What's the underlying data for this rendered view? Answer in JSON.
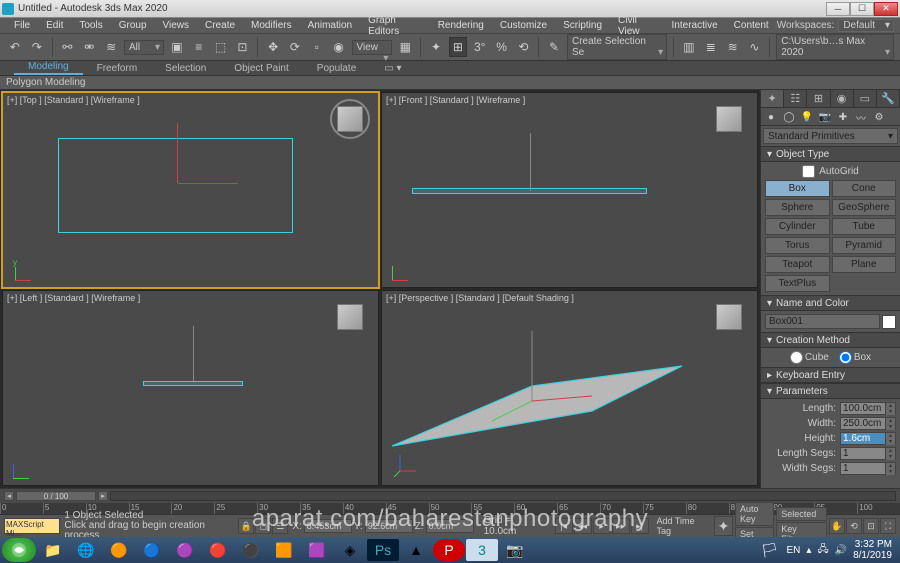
{
  "title": "Untitled - Autodesk 3ds Max 2020",
  "menus": [
    "File",
    "Edit",
    "Tools",
    "Group",
    "Views",
    "Create",
    "Modifiers",
    "Animation",
    "Graph Editors",
    "Rendering",
    "Customize",
    "Scripting",
    "Civil View",
    "Interactive",
    "Content"
  ],
  "workspaces_label": "Workspaces:",
  "workspaces_value": "Default",
  "toolbar_drop_all": "All",
  "toolbar_drop_view": "View",
  "toolbar_drop_sel": "Create Selection Se",
  "toolbar_path": "C:\\Users\\b…s Max 2020",
  "ribbon_tabs": [
    "Modeling",
    "Freeform",
    "Selection",
    "Object Paint",
    "Populate"
  ],
  "ribbon_sub": "Polygon Modeling",
  "viewports": {
    "top": "[+] [Top ] [Standard ] [Wireframe ]",
    "front": "[+] [Front ] [Standard ] [Wireframe ]",
    "left": "[+] [Left ] [Standard ] [Wireframe ]",
    "persp": "[+] [Perspective ] [Standard ] [Default Shading ]"
  },
  "cmd": {
    "category": "Standard Primitives",
    "rollouts": {
      "object_type": "Object Type",
      "autogrid": "AutoGrid",
      "primitives": [
        "Box",
        "Cone",
        "Sphere",
        "GeoSphere",
        "Cylinder",
        "Tube",
        "Torus",
        "Pyramid",
        "Teapot",
        "Plane",
        "TextPlus"
      ],
      "name_color": "Name and Color",
      "name_value": "Box001",
      "creation": "Creation Method",
      "creation_opts": [
        "Cube",
        "Box"
      ],
      "keyboard": "Keyboard Entry",
      "params": "Parameters",
      "length_lbl": "Length:",
      "length_val": "100.0cm",
      "width_lbl": "Width:",
      "width_val": "250.0cm",
      "height_lbl": "Height:",
      "height_val": "1.6cm",
      "lsegs_lbl": "Length Segs:",
      "lsegs_val": "1",
      "wsegs_lbl": "Width Segs:",
      "wsegs_val": "1"
    }
  },
  "timeline": {
    "frame": "0 / 100",
    "ticks": [
      "0",
      "5",
      "10",
      "15",
      "20",
      "25",
      "30",
      "35",
      "40",
      "45",
      "50",
      "55",
      "60",
      "65",
      "70",
      "75",
      "80",
      "85",
      "90",
      "95",
      "100"
    ]
  },
  "status": {
    "script": "MAXScript Mi…",
    "selected": "1 Object Selected",
    "hint": "Click and drag to begin creation process",
    "x_lbl": "X:",
    "x": "8.453cm",
    "y_lbl": "Y:",
    "y": "92.6cm",
    "z_lbl": "Z:",
    "z": "0.0cm",
    "grid": "Grid = 10.0cm",
    "addtime": "Add Time Tag",
    "autokey": "Auto Key",
    "setkey": "Set Key",
    "selected_drop": "Selected",
    "keyfilters": "Key Filters..."
  },
  "tray": {
    "lang": "EN",
    "time": "3:32 PM",
    "date": "8/1/2019"
  },
  "watermark": "aparat.com/baharestanphotography"
}
